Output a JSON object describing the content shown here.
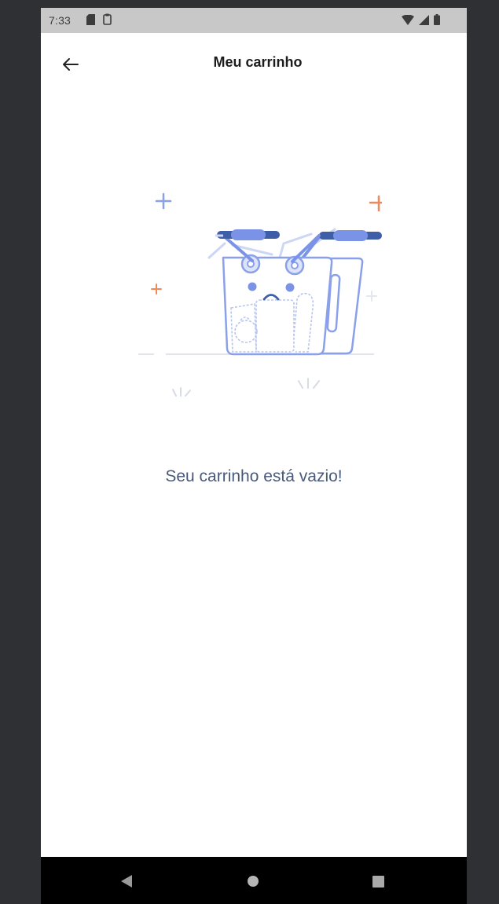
{
  "status_bar": {
    "time": "7:33",
    "left_icons": [
      "sd-card-icon",
      "clipboard-icon"
    ],
    "right_icons": [
      "wifi-icon",
      "signal-icon",
      "battery-icon"
    ]
  },
  "app_bar": {
    "title": "Meu carrinho",
    "back_icon": "arrow-left-icon"
  },
  "empty_state": {
    "illustration": "empty-basket-illustration",
    "message": "Seu carrinho está vazio!"
  },
  "nav_bar": {
    "buttons": [
      "back-triangle-icon",
      "home-circle-icon",
      "recents-square-icon"
    ]
  },
  "colors": {
    "background_frame": "#2f3033",
    "status_bar": "#c8c8c8",
    "page": "#ffffff",
    "accent_blue": "#7b93e6",
    "dark_blue": "#3f5ea8",
    "accent_orange": "#f2895a",
    "message_text": "#4a5a7a"
  }
}
